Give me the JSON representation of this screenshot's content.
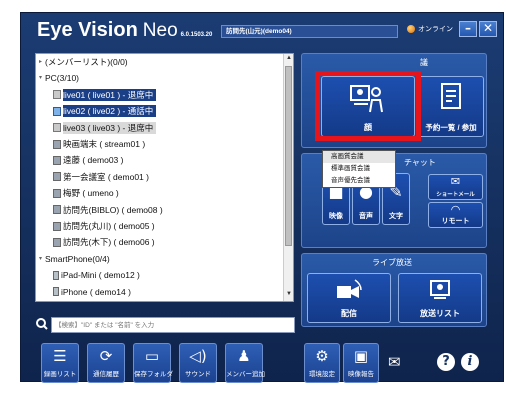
{
  "app": {
    "title_main": "Eye Vision",
    "title_neo": "Neo",
    "version": "6.0.1503.20",
    "user_box": "訪問先(山元)(demo04)",
    "status_text": "オンライン",
    "min_label": "–",
    "close_label": "✕"
  },
  "tree": {
    "items": [
      {
        "arrow": "▸",
        "icon": "none",
        "label": "(メンバーリスト)(0/0)",
        "indent": 0,
        "style": ""
      },
      {
        "arrow": "▾",
        "icon": "none",
        "label": "PC(3/10)",
        "indent": 0,
        "style": ""
      },
      {
        "arrow": "",
        "icon": "pc-leave",
        "label": "live01 ( live01 ) - 退席中",
        "indent": 1,
        "style": "sel"
      },
      {
        "arrow": "",
        "icon": "pc-call",
        "label": "live02 ( live02 ) - 通話中",
        "indent": 1,
        "style": "sel"
      },
      {
        "arrow": "",
        "icon": "pc-leave",
        "label": "live03 ( live03 ) - 退席中",
        "indent": 1,
        "style": "sel-light"
      },
      {
        "arrow": "",
        "icon": "pc",
        "label": "映画端末 ( stream01 )",
        "indent": 1,
        "style": ""
      },
      {
        "arrow": "",
        "icon": "pc",
        "label": "遠藤 ( demo03 )",
        "indent": 1,
        "style": ""
      },
      {
        "arrow": "",
        "icon": "pc",
        "label": "第一会議室 ( demo01 )",
        "indent": 1,
        "style": ""
      },
      {
        "arrow": "",
        "icon": "pc",
        "label": "梅野 ( umeno )",
        "indent": 1,
        "style": ""
      },
      {
        "arrow": "",
        "icon": "pc",
        "label": "訪問先(BIBLO) ( demo08 )",
        "indent": 1,
        "style": ""
      },
      {
        "arrow": "",
        "icon": "pc",
        "label": "訪問先(丸川) ( demo05 )",
        "indent": 1,
        "style": ""
      },
      {
        "arrow": "",
        "icon": "pc",
        "label": "訪問先(木下) ( demo06 )",
        "indent": 1,
        "style": ""
      },
      {
        "arrow": "▾",
        "icon": "none",
        "label": "SmartPhone(0/4)",
        "indent": 0,
        "style": ""
      },
      {
        "arrow": "",
        "icon": "phone",
        "label": "iPad-Mini ( demo12 )",
        "indent": 1,
        "style": ""
      },
      {
        "arrow": "",
        "icon": "phone",
        "label": "iPhone ( demo14 )",
        "indent": 1,
        "style": ""
      }
    ]
  },
  "search": {
    "placeholder": "【検索】\"ID\" または \"名前\" を入力"
  },
  "toolbar": [
    {
      "label": "録画リスト",
      "icon": "list-icon",
      "glyph": "☰"
    },
    {
      "label": "通信履歴",
      "icon": "history-icon",
      "glyph": "⟳"
    },
    {
      "label": "保存フォルダ",
      "icon": "folder-icon",
      "glyph": "▭"
    },
    {
      "label": "サウンド",
      "icon": "sound-icon",
      "glyph": "◁)"
    },
    {
      "label": "メンバー追加",
      "icon": "add-member-icon",
      "glyph": "♟"
    }
  ],
  "meeting": {
    "title": "議",
    "video_label": "顔",
    "schedule_label": "予約一覧 / 参加",
    "dropdown": [
      "高画質会議",
      "標準画質会議",
      "音声優先会議"
    ]
  },
  "chat": {
    "title": "チャット",
    "buttons": [
      {
        "label": "映像",
        "icon": "camera-icon",
        "glyph": "■"
      },
      {
        "label": "音声",
        "icon": "mic-icon",
        "glyph": "●"
      },
      {
        "label": "文字",
        "icon": "pen-icon",
        "glyph": "✎"
      }
    ],
    "side_buttons": [
      {
        "label": "ショートメール",
        "icon": "mail-icon",
        "glyph": "✉"
      },
      {
        "label": "リモート",
        "icon": "wifi-icon",
        "glyph": "◠"
      }
    ]
  },
  "live": {
    "title": "ライブ放送",
    "broadcast_label": "配信",
    "list_label": "放送リスト"
  },
  "bottom": {
    "settings_label": "環境設定",
    "report_label": "映像報告",
    "help_label": "?",
    "info_label": "i"
  },
  "colors": {
    "highlight": "#e8141c",
    "selected_row": "#1b3f86",
    "window_bg": "#163262"
  }
}
